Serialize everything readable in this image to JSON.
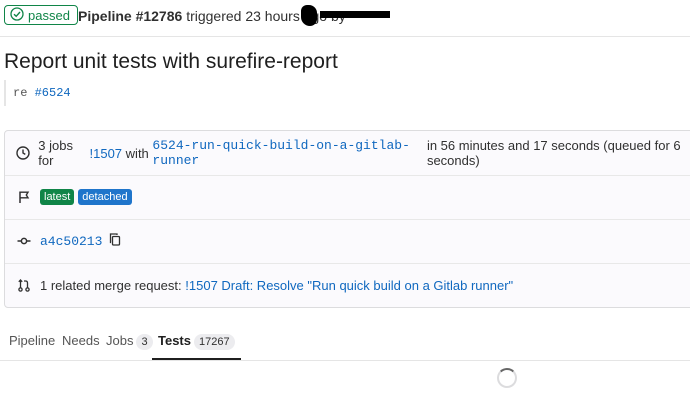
{
  "header": {
    "status": "passed",
    "pipeline_label": "Pipeline #12786",
    "triggered_text": "triggered 23 hours ago by"
  },
  "title": "Report unit tests with surefire-report",
  "description": {
    "prefix": "re",
    "issue_link": "#6524"
  },
  "info": {
    "jobs_prefix": "3 jobs for",
    "mr_ref": "!1507",
    "with": "with",
    "branch": "6524-run-quick-build-on-a-gitlab-runner",
    "duration": "in 56 minutes and 17 seconds (queued for 6 seconds)",
    "badges": [
      "latest",
      "detached"
    ],
    "commit_sha": "a4c50213",
    "related_text": "1 related merge request:",
    "related_link": "!1507 Draft: Resolve \"Run quick build on a Gitlab runner\""
  },
  "tabs": [
    {
      "label": "Pipeline"
    },
    {
      "label": "Needs"
    },
    {
      "label": "Jobs",
      "count": "3"
    },
    {
      "label": "Tests",
      "count": "17267"
    }
  ],
  "colors": {
    "success": "#108548",
    "link": "#1068bf",
    "detached": "#1f75cb"
  }
}
